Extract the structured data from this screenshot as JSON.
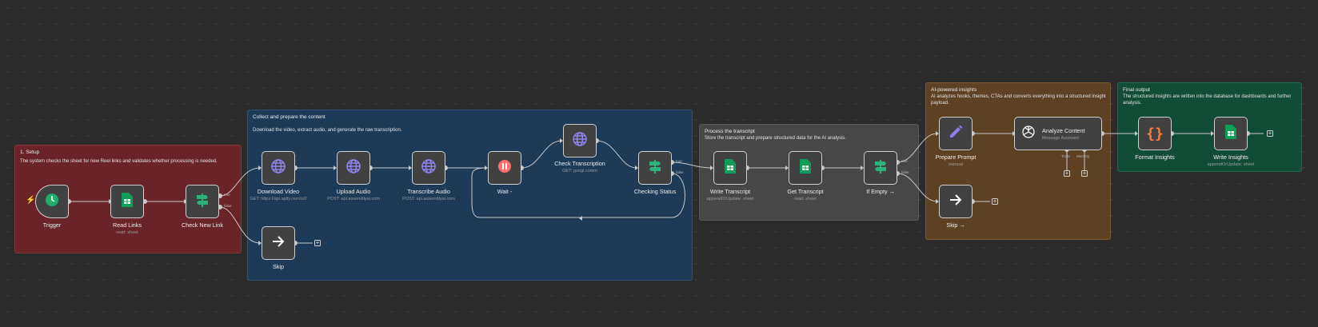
{
  "groups": {
    "setup": {
      "title": "1. Setup",
      "desc": "The system checks the sheet for new Reel links and validates whether processing is needed."
    },
    "collect": {
      "title": "Collect and prepare the content",
      "desc": "Download the video, extract audio, and generate the raw transcription."
    },
    "process": {
      "title": "Process the transcript",
      "desc": "Store the transcript and prepare structured data for the AI analysis."
    },
    "ai": {
      "title": "AI-powered insights",
      "desc": "AI analyzes hooks, themes, CTAs and converts everything into a structured insight payload."
    },
    "output": {
      "title": "Final output",
      "desc": "The structured insights are written into the database for dashboards and further analysis."
    }
  },
  "nodes": {
    "trigger": {
      "label": "Trigger",
      "sub": ""
    },
    "read_links": {
      "label": "Read Links",
      "sub": "read: sheet"
    },
    "check_new_link": {
      "label": "Check New Link",
      "sub": ""
    },
    "skip1": {
      "label": "Skip",
      "sub": ""
    },
    "download_video": {
      "label": "Download Video",
      "sub": "GET: https://api.apify.com/v2/"
    },
    "upload_audio": {
      "label": "Upload Audio",
      "sub": "POST: api.assemblyai.com"
    },
    "transcribe_audio": {
      "label": "Transcribe Audio",
      "sub": "POST: api.assemblyai.com"
    },
    "wait": {
      "label": "Wait -",
      "sub": ""
    },
    "check_transcription": {
      "label": "Check Transcription",
      "sub": "GET: googl.comm"
    },
    "checking_status": {
      "label": "Checking Status",
      "sub": ""
    },
    "write_transcript": {
      "label": "Write Transcript",
      "sub": "appendOrUpdate: sheet"
    },
    "get_transcript": {
      "label": "Get Transcript",
      "sub": "read: sheet"
    },
    "if_empty": {
      "label": "If Empty →",
      "sub": ""
    },
    "skip2": {
      "label": "Skip →",
      "sub": ""
    },
    "prepare_prompt": {
      "label": "Prepare Prompt",
      "sub": "manual"
    },
    "analyze_content": {
      "label": "Analyze Content",
      "sub": "Message Assistant"
    },
    "format_insights": {
      "label": "Format Insights",
      "sub": ""
    },
    "write_insights": {
      "label": "Write Insights",
      "sub": "appendOrUpdate: sheet"
    }
  },
  "ports": {
    "true": "true",
    "false": "false",
    "tools": "Tools",
    "memory": "Memory"
  },
  "icons": {
    "trigger": "clock-icon",
    "sheets": "google-sheets-icon",
    "if": "signpost-icon",
    "http": "globe-icon",
    "wait": "pause-icon",
    "skip": "arrow-right-icon",
    "prompt": "pencil-icon",
    "openai": "openai-icon",
    "code": "curly-braces-icon"
  },
  "colors": {
    "setup": "#6a2328",
    "collect": "#1d3a57",
    "process": "#474747",
    "ai": "#5c4223",
    "output": "#114d36",
    "sheets": "#0f9d58",
    "http": "#8f84f0",
    "wait": "#ff6d6d",
    "prompt": "#8c7ef0",
    "code": "#ff7a45"
  }
}
